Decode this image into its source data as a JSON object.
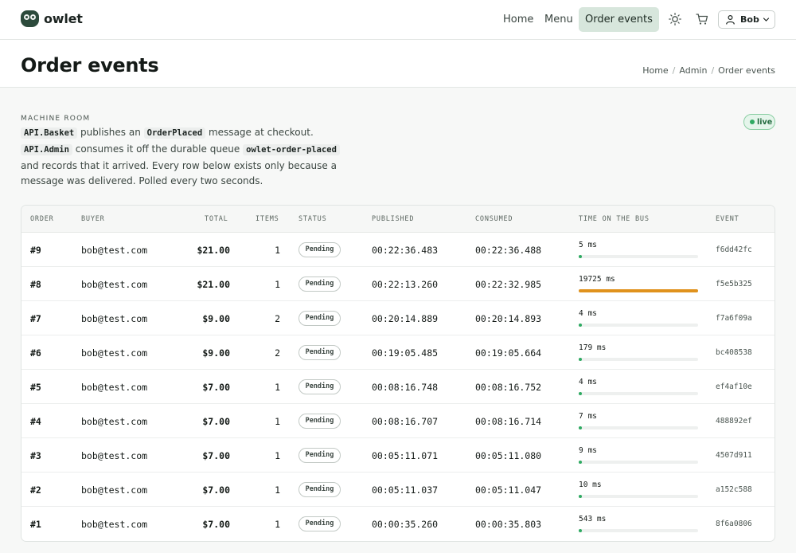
{
  "brand": {
    "name": "owlet"
  },
  "nav": {
    "links": [
      {
        "label": "Home",
        "active": false
      },
      {
        "label": "Menu",
        "active": false
      },
      {
        "label": "Order events",
        "active": true
      }
    ],
    "theme_icon": "sun-icon",
    "cart_icon": "cart-icon",
    "user": {
      "name": "Bob",
      "icon": "user-icon",
      "chevron": "chevron-down-icon"
    }
  },
  "page": {
    "title": "Order events",
    "breadcrumb": [
      "Home",
      "Admin",
      "Order events"
    ]
  },
  "intro": {
    "eyebrow": "MACHINE ROOM",
    "p1_code": "API.Basket",
    "p1_text": " publishes an ",
    "p2_code": "OrderPlaced",
    "p2_text": " message at checkout. ",
    "p3_code": "API.Admin",
    "p3_text": " consumes it off the durable queue ",
    "p4_code": "owlet-order-placed",
    "p4_text": " and records that it arrived. Every row below exists only because a message was delivered. Polled every two seconds.",
    "live_label": "live"
  },
  "table": {
    "columns": {
      "order": "ORDER",
      "buyer": "BUYER",
      "total": "TOTAL",
      "items": "ITEMS",
      "status": "STATUS",
      "published": "PUBLISHED",
      "consumed": "CONSUMED",
      "bus": "TIME ON THE BUS",
      "event": "EVENT"
    },
    "rows": [
      {
        "order": "#9",
        "buyer": "bob@test.com",
        "total": "$21.00",
        "items": "1",
        "status": "Pending",
        "published": "00:22:36.483",
        "consumed": "00:22:36.488",
        "bus_label": "5 ms",
        "bus_ms": 5,
        "event": "f6dd42fc"
      },
      {
        "order": "#8",
        "buyer": "bob@test.com",
        "total": "$21.00",
        "items": "1",
        "status": "Pending",
        "published": "00:22:13.260",
        "consumed": "00:22:32.985",
        "bus_label": "19725 ms",
        "bus_ms": 19725,
        "event": "f5e5b325"
      },
      {
        "order": "#7",
        "buyer": "bob@test.com",
        "total": "$9.00",
        "items": "2",
        "status": "Pending",
        "published": "00:20:14.889",
        "consumed": "00:20:14.893",
        "bus_label": "4 ms",
        "bus_ms": 4,
        "event": "f7a6f09a"
      },
      {
        "order": "#6",
        "buyer": "bob@test.com",
        "total": "$9.00",
        "items": "2",
        "status": "Pending",
        "published": "00:19:05.485",
        "consumed": "00:19:05.664",
        "bus_label": "179 ms",
        "bus_ms": 179,
        "event": "bc408538"
      },
      {
        "order": "#5",
        "buyer": "bob@test.com",
        "total": "$7.00",
        "items": "1",
        "status": "Pending",
        "published": "00:08:16.748",
        "consumed": "00:08:16.752",
        "bus_label": "4 ms",
        "bus_ms": 4,
        "event": "ef4af10e"
      },
      {
        "order": "#4",
        "buyer": "bob@test.com",
        "total": "$7.00",
        "items": "1",
        "status": "Pending",
        "published": "00:08:16.707",
        "consumed": "00:08:16.714",
        "bus_label": "7 ms",
        "bus_ms": 7,
        "event": "488892ef"
      },
      {
        "order": "#3",
        "buyer": "bob@test.com",
        "total": "$7.00",
        "items": "1",
        "status": "Pending",
        "published": "00:05:11.071",
        "consumed": "00:05:11.080",
        "bus_label": "9 ms",
        "bus_ms": 9,
        "event": "4507d911"
      },
      {
        "order": "#2",
        "buyer": "bob@test.com",
        "total": "$7.00",
        "items": "1",
        "status": "Pending",
        "published": "00:05:11.037",
        "consumed": "00:05:11.047",
        "bus_label": "10 ms",
        "bus_ms": 10,
        "event": "a152c588"
      },
      {
        "order": "#1",
        "buyer": "bob@test.com",
        "total": "$7.00",
        "items": "1",
        "status": "Pending",
        "published": "00:00:35.260",
        "consumed": "00:00:35.803",
        "bus_label": "543 ms",
        "bus_ms": 543,
        "event": "8f6a0806"
      }
    ]
  },
  "colors": {
    "accent_green": "#2faa62",
    "warn_orange": "#e0921d",
    "nav_active_bg": "#d7e6dc"
  }
}
